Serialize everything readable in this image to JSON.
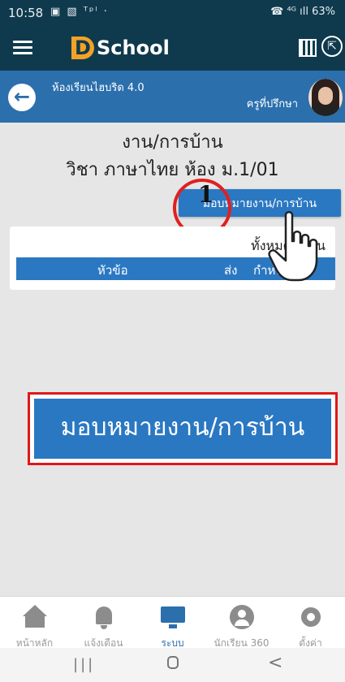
{
  "status_bar": {
    "time": "10:58",
    "left_icons": "▣ ▧ ᵀᵖˡ ·",
    "right_text": "☎ ⁴ᴳ ıll 63%"
  },
  "app_header": {
    "logo_letter": "D",
    "logo_text": "School",
    "share_glyph": "⇱"
  },
  "class_header": {
    "class_name": "ห้องเรียนไฮบริด 4.0",
    "advisor_label": "ครูที่ปรึกษา",
    "back_glyph": "←"
  },
  "content": {
    "page_title": "งาน/การบ้าน",
    "subject_line": "วิชา ภาษาไทย ห้อง ม.1/01",
    "assign_button_label": "มอบหมายงาน/การบ้าน",
    "step_number": "1",
    "total_label": "ทั้งหมด 0 คน",
    "table": {
      "col_topic": "หัวข้อ",
      "col_sent": "ส่ง",
      "col_due": "กำหนดส่ง"
    },
    "callout_button_label": "มอบหมายงาน/การบ้าน"
  },
  "bottom_nav": {
    "items": [
      {
        "label": "หน้าหลัก",
        "icon": "home-icon"
      },
      {
        "label": "แจ้งเตือน",
        "icon": "bell-icon"
      },
      {
        "label": "ระบบ",
        "icon": "monitor-icon"
      },
      {
        "label": "นักเรียน 360",
        "icon": "user-circle-icon"
      },
      {
        "label": "ตั้งค่า",
        "icon": "gear-icon"
      }
    ],
    "active_index": 2
  },
  "system_nav": {
    "recent_glyph": "|||",
    "back_glyph": "<"
  },
  "colors": {
    "header_bg": "#0f3a4d",
    "class_header_bg": "#2b6fad",
    "button_blue": "#2b78c2",
    "highlight_red": "#e01818",
    "logo_orange": "#f2a227"
  }
}
